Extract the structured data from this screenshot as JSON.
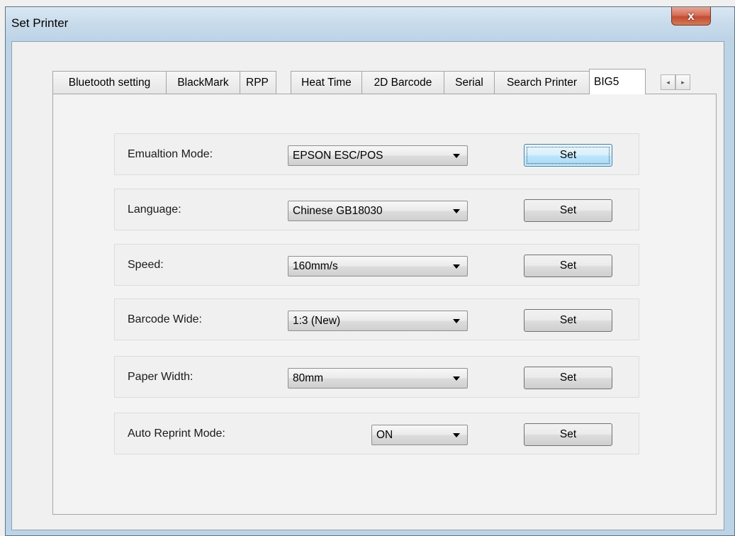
{
  "window": {
    "title": "Set Printer",
    "close_glyph": "x"
  },
  "tabs": [
    {
      "label": "Bluetooth setting"
    },
    {
      "label": "BlackMark"
    },
    {
      "label": "RPP"
    },
    {
      "label": "Heat Time"
    },
    {
      "label": "2D Barcode"
    },
    {
      "label": "Serial"
    },
    {
      "label": "Search Printer"
    },
    {
      "label": "BIG5",
      "active": true
    }
  ],
  "tab_scroll": {
    "left_glyph": "◂",
    "right_glyph": "▸"
  },
  "settings": [
    {
      "label": "Emualtion Mode:",
      "value": "EPSON ESC/POS",
      "button": "Set"
    },
    {
      "label": "Language:",
      "value": "Chinese GB18030",
      "button": "Set"
    },
    {
      "label": "Speed:",
      "value": "160mm/s",
      "button": "Set"
    },
    {
      "label": "Barcode Wide:",
      "value": "1:3 (New)",
      "button": "Set"
    },
    {
      "label": "Paper Width:",
      "value": "80mm",
      "button": "Set"
    },
    {
      "label": "Auto Reprint Mode:",
      "value": "ON",
      "button": "Set"
    }
  ],
  "colors": {
    "frame": "#bcd4e6",
    "close": "#c24d33",
    "focus": "#3c7fb1"
  }
}
